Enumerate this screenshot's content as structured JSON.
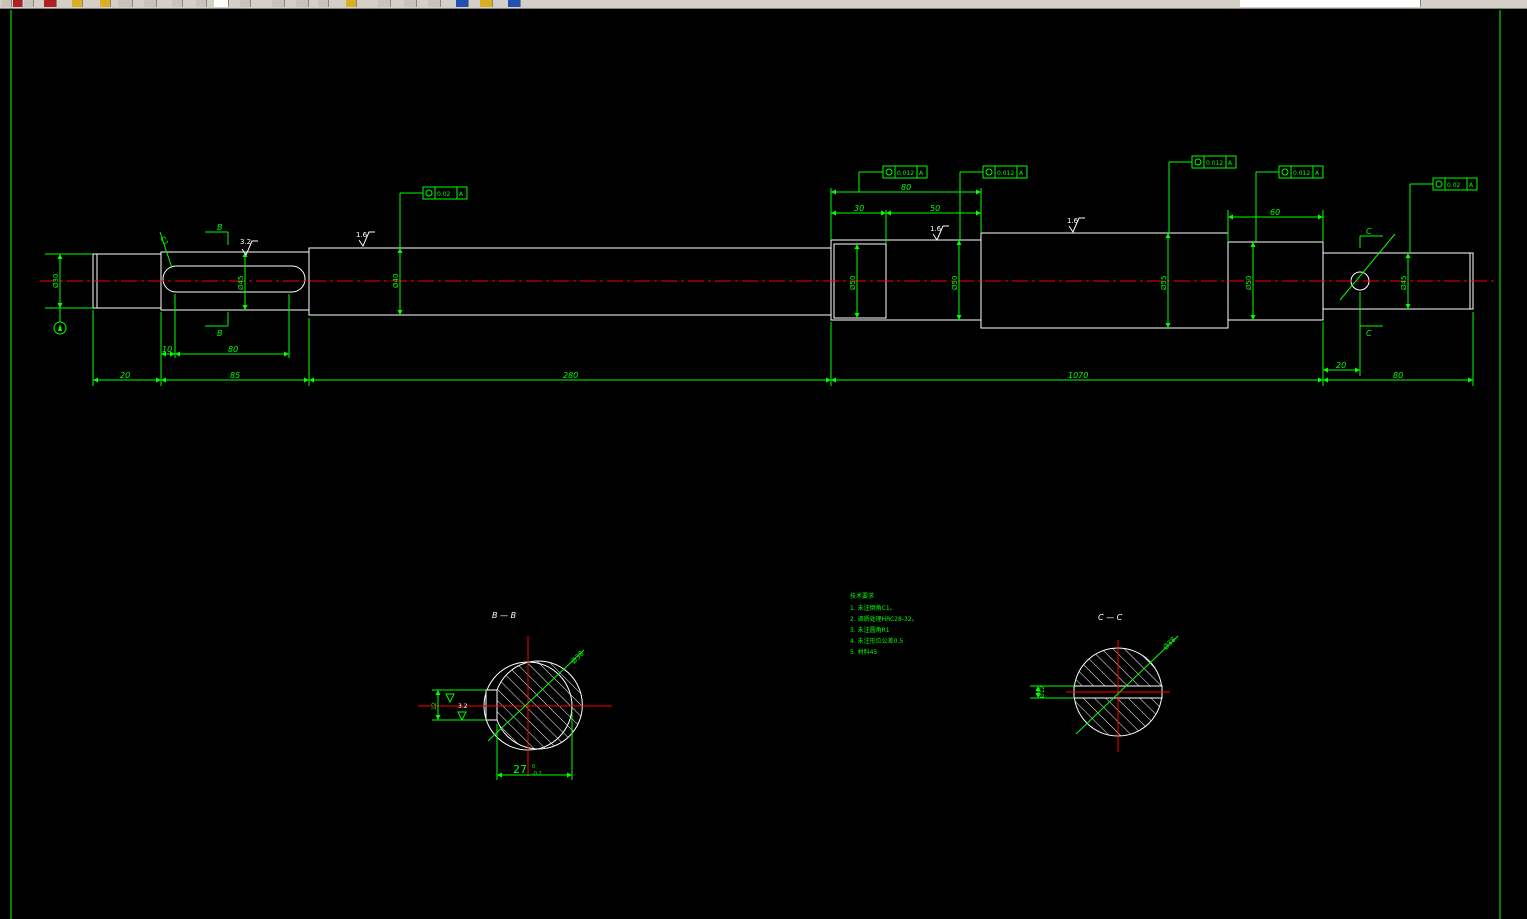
{
  "app": {
    "toolbar_buttons": [
      "new",
      "open",
      "save",
      "print",
      "cut",
      "copy",
      "paste",
      "undo",
      "redo",
      "pan",
      "zoom-realtime",
      "zoom-window",
      "zoom-previous",
      "properties",
      "designcenter",
      "tool-palettes",
      "help"
    ]
  },
  "colors": {
    "background": "#000000",
    "geometry": "#ffffff",
    "dimension": "#00ff00",
    "centerline": "#ff0000",
    "hatch": "#ffffff",
    "toolbar": "#d4d0c8"
  },
  "drawing": {
    "dims": {
      "d20": "20",
      "d85": "85",
      "d280": "280",
      "d1070": "1070",
      "d20b": "20",
      "d80a": "80",
      "d10": "10",
      "d80b": "80",
      "d80c": "80",
      "d30": "30",
      "d50": "50",
      "d60": "60"
    },
    "diameters": {
      "end_left": "Ø30",
      "key_seat": "Ø45",
      "shaft_main": "Ø40",
      "bearing_left": "Ø50",
      "step": "Ø50",
      "collar": "Ø55",
      "bearing_right": "Ø50",
      "end_right": "Ø45",
      "chamfer": "C1"
    },
    "roughness": {
      "r1": "3.2",
      "r2": "1.6",
      "r3": "1.6",
      "r4": "1.6"
    },
    "tolerance_frames": {
      "t1": "0.02",
      "t2": "0.012",
      "t3": "0.012",
      "t4": "0.012",
      "t5": "0.012",
      "t6": "0.02",
      "datum": "A"
    },
    "section_labels": {
      "b_top": "B",
      "b_bottom": "B",
      "c_top": "C",
      "c_bottom": "C",
      "bb": "B — B",
      "cc": "C — C"
    },
    "section_bb": {
      "dia": "Ø38",
      "width": "27",
      "tol_upper": "0",
      "tol_lower": "-0.2",
      "rough": "3.2",
      "key": "12"
    },
    "section_cc": {
      "dia": "Ø38",
      "hole": "Ø12"
    },
    "notes": {
      "title": "技术要求",
      "lines": [
        "1. 未注倒角C1。",
        "2. 调质处理HRC28-32。",
        "3. 未注圆角R1",
        "4. 未注形位公差0.5",
        "5. 材料45"
      ]
    }
  }
}
